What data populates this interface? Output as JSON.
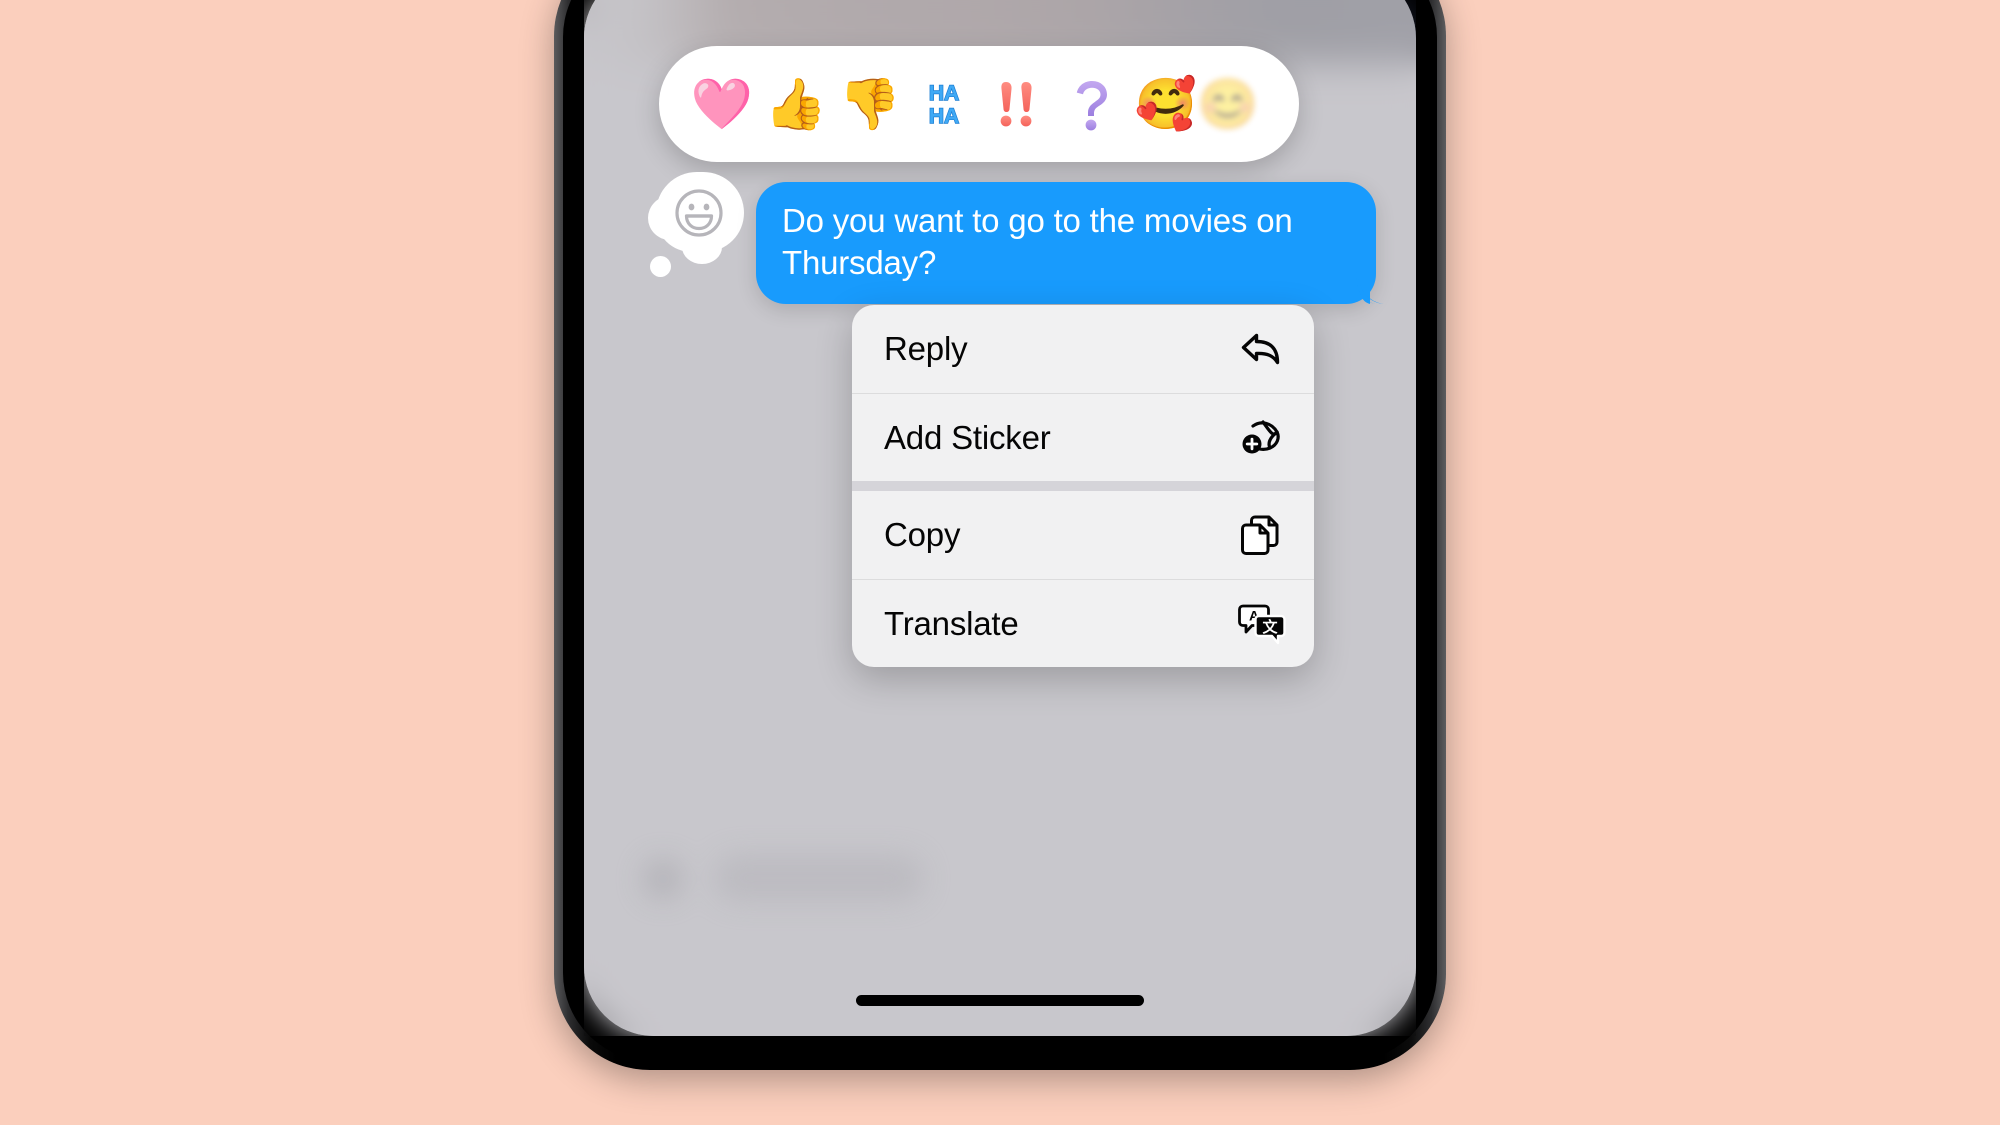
{
  "background": {
    "color": "#fbcfbd"
  },
  "device": {
    "name": "iPhone",
    "bezel_color": "#000000",
    "screen_background": "#c8c7cc",
    "home_indicator": "home-indicator"
  },
  "tapback_bar": {
    "background": "#ffffff",
    "reactions": [
      {
        "name": "heart",
        "glyph": "🩷",
        "label": "Heart"
      },
      {
        "name": "thumbs-up",
        "glyph": "👍",
        "label": "Thumbs Up"
      },
      {
        "name": "thumbs-down",
        "glyph": "👎",
        "label": "Thumbs Down"
      },
      {
        "name": "haha",
        "glyph": "🆗",
        "label": "Haha"
      },
      {
        "name": "exclamation",
        "glyph": "❗❗",
        "label": "Exclamation"
      },
      {
        "name": "question",
        "glyph": "❓",
        "label": "Question"
      },
      {
        "name": "smiling-face-with-hearts",
        "glyph": "🥰",
        "label": "Smiling Face with Hearts"
      },
      {
        "name": "more-emoji-partial",
        "glyph": "😊",
        "label": "More"
      }
    ]
  },
  "message": {
    "tapback_affordance_icon": "smiley-thought-bubble-icon",
    "bubble_text": "Do you want to go to the movies on Thursday?",
    "bubble_color": "#189bfd",
    "bubble_text_color": "#ffffff",
    "sender": "outgoing"
  },
  "context_menu": {
    "background": "#f1f1f2",
    "groups": [
      {
        "items": [
          {
            "label": "Reply",
            "icon": "reply-arrow-icon"
          },
          {
            "label": "Add Sticker",
            "icon": "add-sticker-icon"
          }
        ]
      },
      {
        "items": [
          {
            "label": "Copy",
            "icon": "copy-documents-icon"
          },
          {
            "label": "Translate",
            "icon": "translate-speech-bubbles-icon"
          }
        ]
      }
    ]
  }
}
